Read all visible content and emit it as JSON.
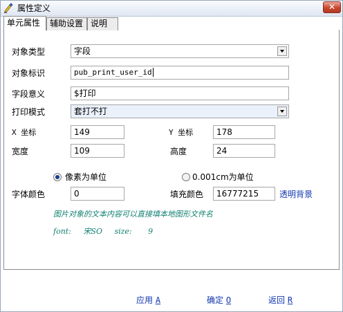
{
  "window": {
    "title": "属性定义",
    "close_label": "✕"
  },
  "tabs": [
    {
      "label": "单元属性"
    },
    {
      "label": "辅助设置"
    },
    {
      "label": "说明"
    }
  ],
  "form": {
    "object_type": {
      "label": "对象类型",
      "value": "字段"
    },
    "object_id": {
      "label": "对象标识",
      "value": "pub_print_user_id"
    },
    "field_meaning": {
      "label": "字段意义",
      "value": "$打印"
    },
    "print_mode": {
      "label": "打印模式",
      "value": "套打不打"
    },
    "x_coord": {
      "label": "X 坐标",
      "value": "149"
    },
    "y_coord": {
      "label": "Y 坐标",
      "value": "178"
    },
    "width": {
      "label": "宽度",
      "value": "109"
    },
    "height": {
      "label": "高度",
      "value": "24"
    },
    "unit_pixel": {
      "label": "像素为单位",
      "checked": true
    },
    "unit_cm": {
      "label": "0.001cm为单位",
      "checked": false
    },
    "font_color": {
      "label": "字体颜色",
      "value": "0"
    },
    "fill_color": {
      "label": "填充颜色",
      "value": "16777215"
    },
    "transparent_bg": "透明背景",
    "hint": "图片对象的文本内容可以直接填本地图形文件名",
    "font_info": {
      "font_label": "font:",
      "font_value": "宋SO",
      "size_label": "size:",
      "size_value": "9"
    }
  },
  "buttons": {
    "apply": {
      "label": "应用",
      "accel": "A"
    },
    "ok": {
      "label": "确定",
      "accel": "O"
    },
    "back": {
      "label": "返回",
      "accel": "R"
    }
  }
}
